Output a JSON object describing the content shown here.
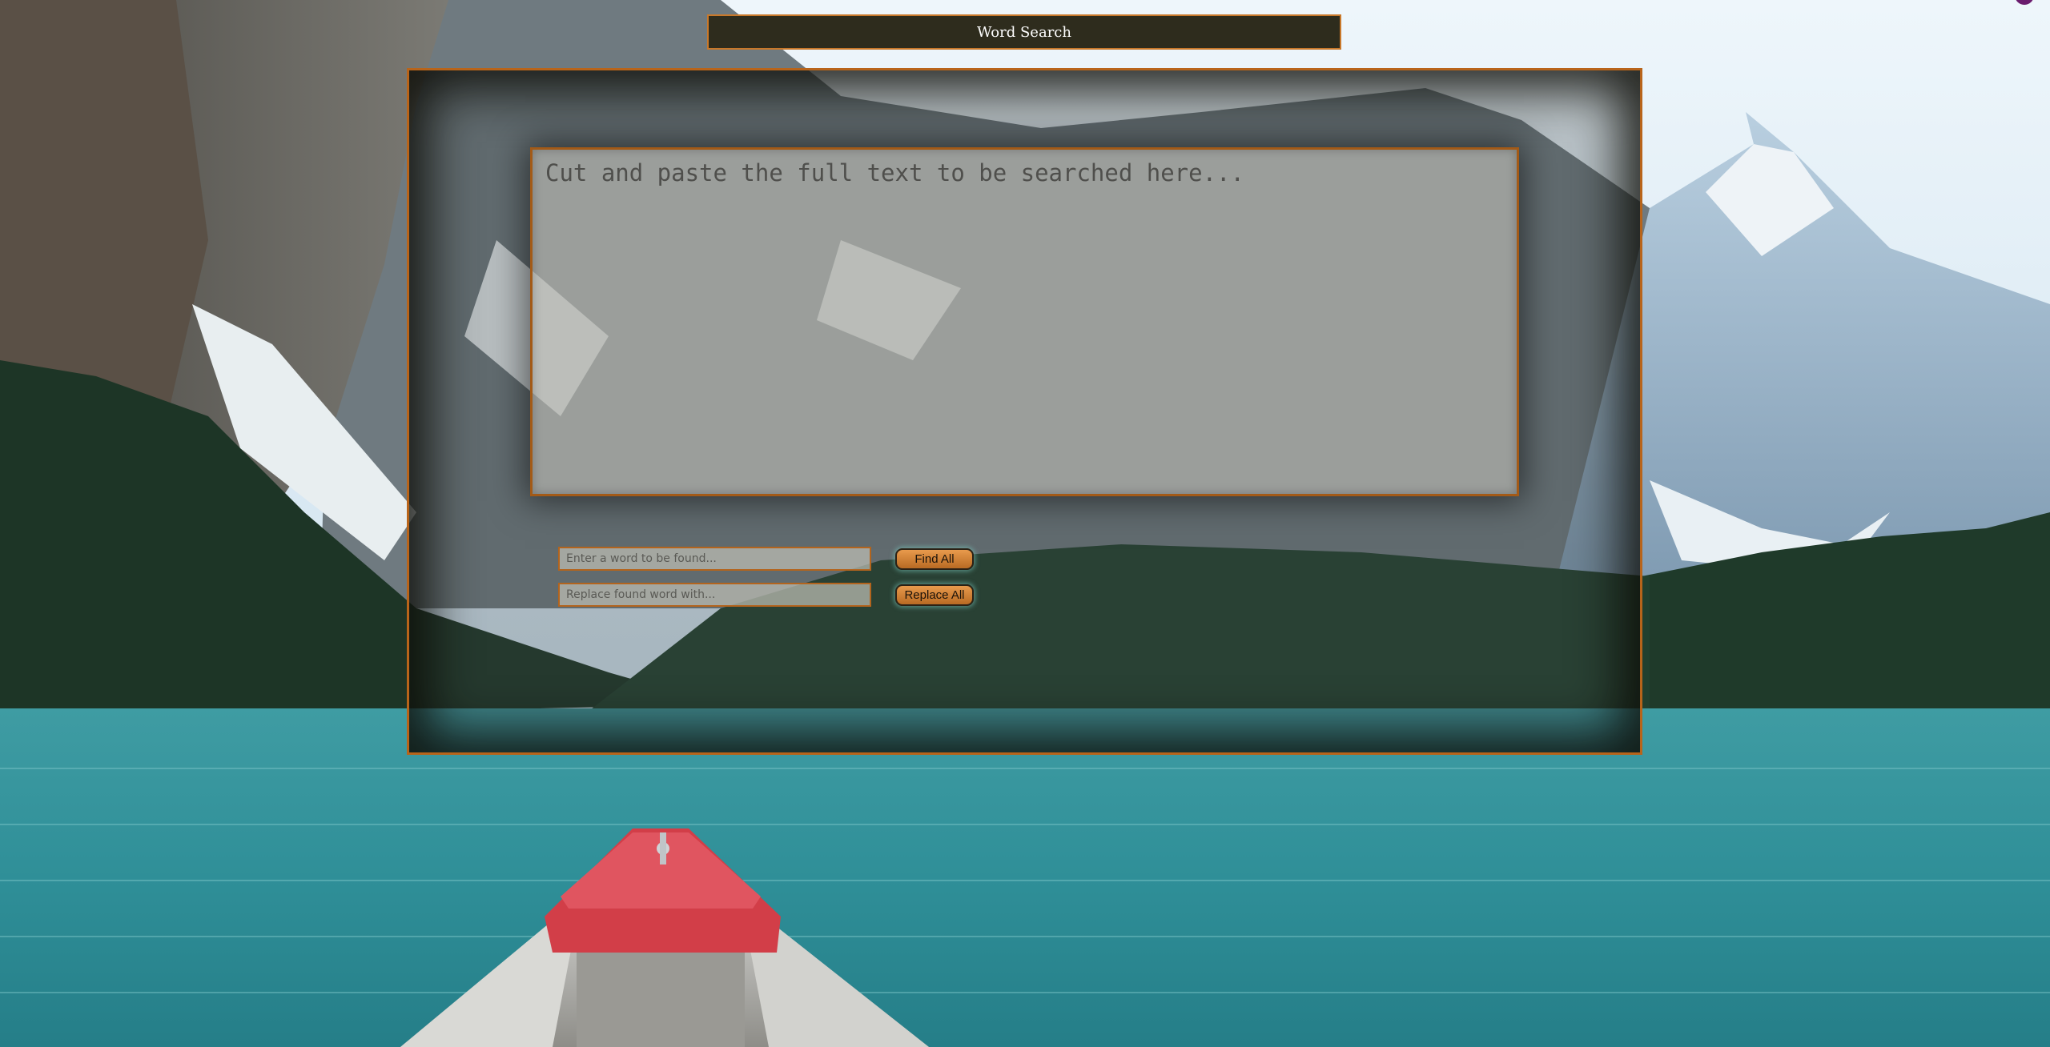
{
  "header": {
    "title": "Word Search"
  },
  "search_text": {
    "placeholder": "Cut and paste the full text to be searched here..."
  },
  "find": {
    "placeholder": "Enter a word to be found...",
    "button_label": "Find All"
  },
  "replace": {
    "placeholder": "Replace found word with...",
    "button_label": "Replace All"
  },
  "colors": {
    "accent": "#c8782a",
    "title_bg": "#2e2c1d",
    "button": "#d9893c"
  }
}
